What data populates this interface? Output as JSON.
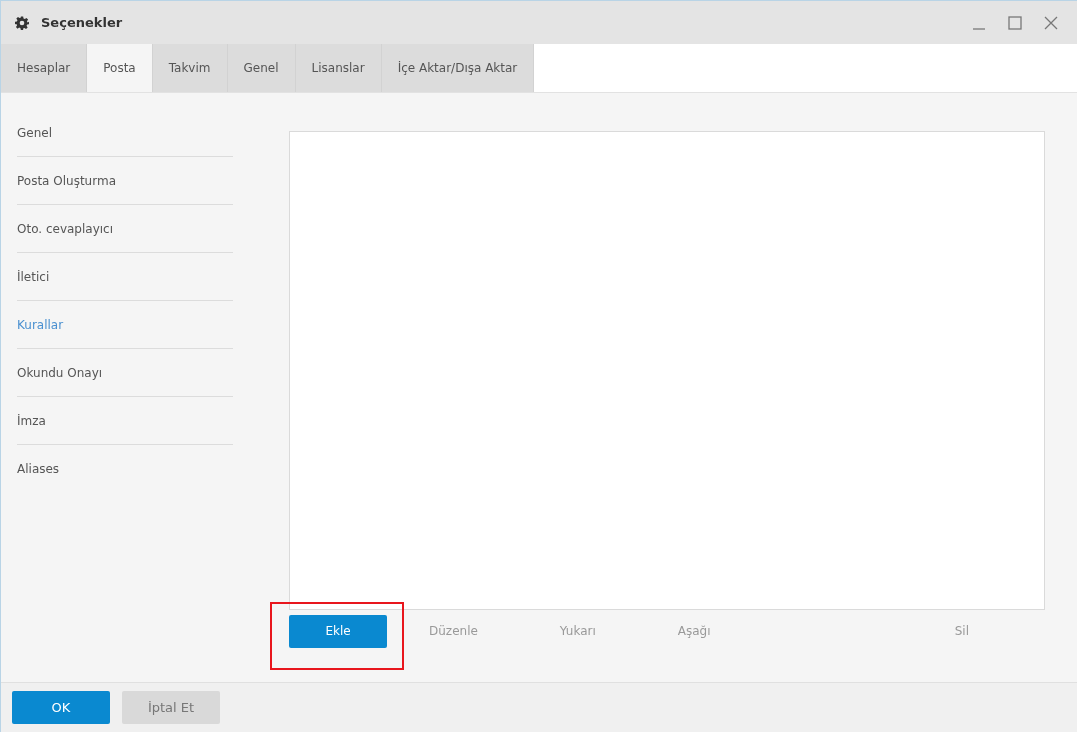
{
  "window": {
    "title": "Seçenekler"
  },
  "tabs": [
    {
      "label": "Hesaplar",
      "selected": false
    },
    {
      "label": "Posta",
      "selected": true
    },
    {
      "label": "Takvim",
      "selected": false
    },
    {
      "label": "Genel",
      "selected": false
    },
    {
      "label": "Lisanslar",
      "selected": false
    },
    {
      "label": "İçe Aktar/Dışa Aktar",
      "selected": false
    }
  ],
  "sidebar": {
    "items": [
      {
        "label": "Genel",
        "selected": false
      },
      {
        "label": "Posta Oluşturma",
        "selected": false
      },
      {
        "label": "Oto. cevaplayıcı",
        "selected": false
      },
      {
        "label": "İletici",
        "selected": false
      },
      {
        "label": "Kurallar",
        "selected": true
      },
      {
        "label": "Okundu Onayı",
        "selected": false
      },
      {
        "label": "İmza",
        "selected": false
      },
      {
        "label": "Aliases",
        "selected": false
      }
    ]
  },
  "rules_actions": [
    {
      "label": "Ekle",
      "kind": "primary",
      "highlighted": true
    },
    {
      "label": "Düzenle",
      "kind": "text",
      "highlighted": false
    },
    {
      "label": "Yukarı",
      "kind": "text",
      "highlighted": false
    },
    {
      "label": "Aşağı",
      "kind": "text",
      "highlighted": false
    },
    {
      "label": "Sil",
      "kind": "text-end",
      "highlighted": false
    }
  ],
  "footer_buttons": [
    {
      "label": "OK",
      "kind": "primary"
    },
    {
      "label": "İptal Et",
      "kind": "secondary"
    }
  ]
}
